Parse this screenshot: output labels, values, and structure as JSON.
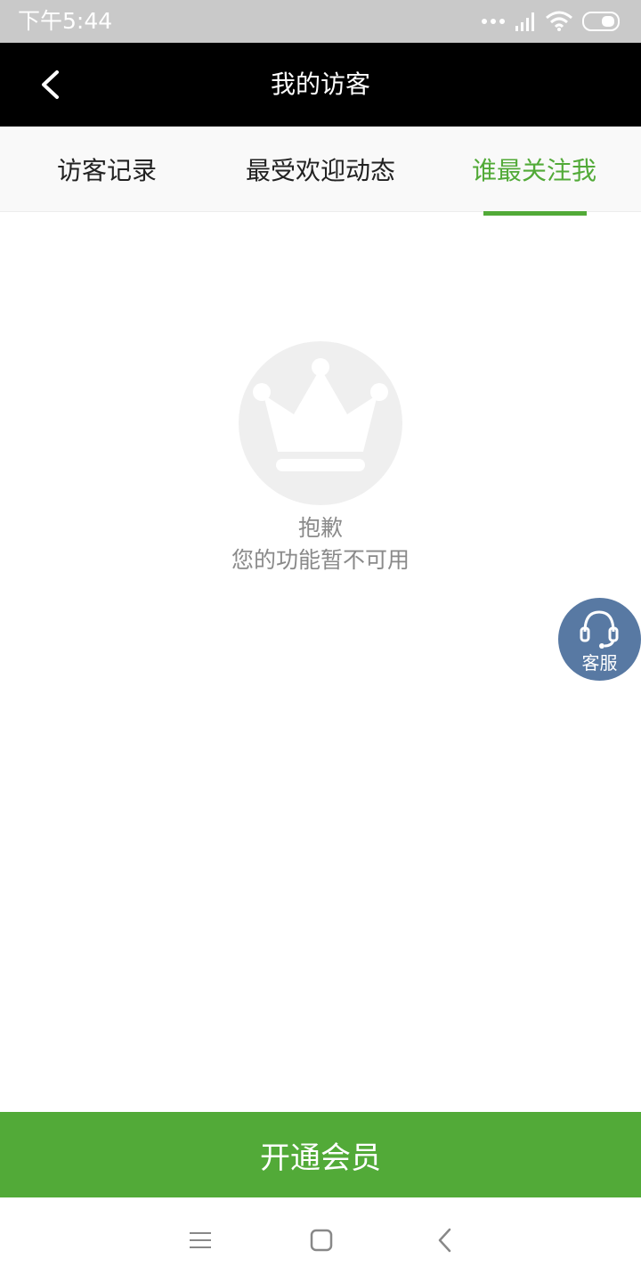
{
  "status_bar": {
    "time": "下午5:44",
    "icons": [
      "dots-icon",
      "signal-icon",
      "wifi-icon",
      "battery-icon"
    ]
  },
  "header": {
    "title": "我的访客",
    "back_icon": "chevron-left-icon"
  },
  "tabs": [
    {
      "label": "访客记录",
      "active": false
    },
    {
      "label": "最受欢迎动态",
      "active": false
    },
    {
      "label": "谁最关注我",
      "active": true
    }
  ],
  "empty_state": {
    "icon": "crown-icon",
    "title": "抱歉",
    "subtitle": "您的功能暂不可用"
  },
  "service_button": {
    "label": "客服",
    "icon": "headset-icon"
  },
  "cta": {
    "label": "开通会员"
  },
  "nav_bar": {
    "icons": [
      "menu-icon",
      "home-icon",
      "back-icon"
    ]
  },
  "colors": {
    "accent": "#52aa38",
    "status_bar": "#c9c9c9",
    "header": "#000000",
    "service_button": "#5879a3",
    "empty_text": "#8a8a8a"
  }
}
